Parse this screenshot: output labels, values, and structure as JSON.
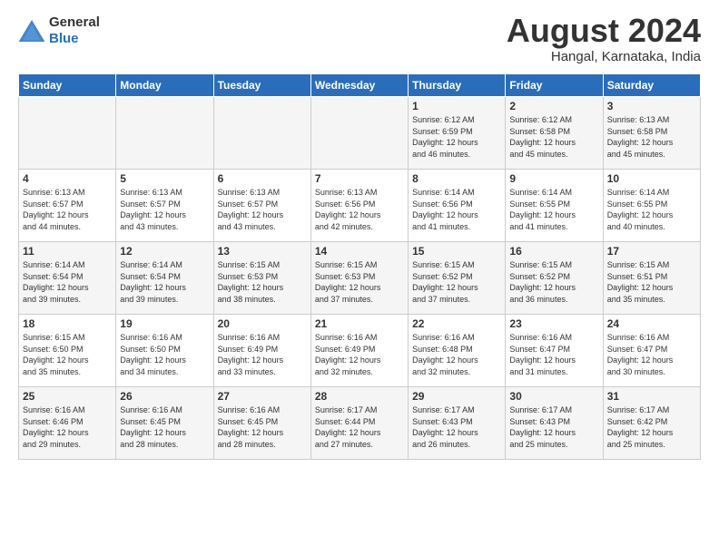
{
  "logo": {
    "text_general": "General",
    "text_blue": "Blue"
  },
  "title": "August 2024",
  "subtitle": "Hangal, Karnataka, India",
  "days_of_week": [
    "Sunday",
    "Monday",
    "Tuesday",
    "Wednesday",
    "Thursday",
    "Friday",
    "Saturday"
  ],
  "weeks": [
    [
      {
        "day": "",
        "info": ""
      },
      {
        "day": "",
        "info": ""
      },
      {
        "day": "",
        "info": ""
      },
      {
        "day": "",
        "info": ""
      },
      {
        "day": "1",
        "info": "Sunrise: 6:12 AM\nSunset: 6:59 PM\nDaylight: 12 hours\nand 46 minutes."
      },
      {
        "day": "2",
        "info": "Sunrise: 6:12 AM\nSunset: 6:58 PM\nDaylight: 12 hours\nand 45 minutes."
      },
      {
        "day": "3",
        "info": "Sunrise: 6:13 AM\nSunset: 6:58 PM\nDaylight: 12 hours\nand 45 minutes."
      }
    ],
    [
      {
        "day": "4",
        "info": "Sunrise: 6:13 AM\nSunset: 6:57 PM\nDaylight: 12 hours\nand 44 minutes."
      },
      {
        "day": "5",
        "info": "Sunrise: 6:13 AM\nSunset: 6:57 PM\nDaylight: 12 hours\nand 43 minutes."
      },
      {
        "day": "6",
        "info": "Sunrise: 6:13 AM\nSunset: 6:57 PM\nDaylight: 12 hours\nand 43 minutes."
      },
      {
        "day": "7",
        "info": "Sunrise: 6:13 AM\nSunset: 6:56 PM\nDaylight: 12 hours\nand 42 minutes."
      },
      {
        "day": "8",
        "info": "Sunrise: 6:14 AM\nSunset: 6:56 PM\nDaylight: 12 hours\nand 41 minutes."
      },
      {
        "day": "9",
        "info": "Sunrise: 6:14 AM\nSunset: 6:55 PM\nDaylight: 12 hours\nand 41 minutes."
      },
      {
        "day": "10",
        "info": "Sunrise: 6:14 AM\nSunset: 6:55 PM\nDaylight: 12 hours\nand 40 minutes."
      }
    ],
    [
      {
        "day": "11",
        "info": "Sunrise: 6:14 AM\nSunset: 6:54 PM\nDaylight: 12 hours\nand 39 minutes."
      },
      {
        "day": "12",
        "info": "Sunrise: 6:14 AM\nSunset: 6:54 PM\nDaylight: 12 hours\nand 39 minutes."
      },
      {
        "day": "13",
        "info": "Sunrise: 6:15 AM\nSunset: 6:53 PM\nDaylight: 12 hours\nand 38 minutes."
      },
      {
        "day": "14",
        "info": "Sunrise: 6:15 AM\nSunset: 6:53 PM\nDaylight: 12 hours\nand 37 minutes."
      },
      {
        "day": "15",
        "info": "Sunrise: 6:15 AM\nSunset: 6:52 PM\nDaylight: 12 hours\nand 37 minutes."
      },
      {
        "day": "16",
        "info": "Sunrise: 6:15 AM\nSunset: 6:52 PM\nDaylight: 12 hours\nand 36 minutes."
      },
      {
        "day": "17",
        "info": "Sunrise: 6:15 AM\nSunset: 6:51 PM\nDaylight: 12 hours\nand 35 minutes."
      }
    ],
    [
      {
        "day": "18",
        "info": "Sunrise: 6:15 AM\nSunset: 6:50 PM\nDaylight: 12 hours\nand 35 minutes."
      },
      {
        "day": "19",
        "info": "Sunrise: 6:16 AM\nSunset: 6:50 PM\nDaylight: 12 hours\nand 34 minutes."
      },
      {
        "day": "20",
        "info": "Sunrise: 6:16 AM\nSunset: 6:49 PM\nDaylight: 12 hours\nand 33 minutes."
      },
      {
        "day": "21",
        "info": "Sunrise: 6:16 AM\nSunset: 6:49 PM\nDaylight: 12 hours\nand 32 minutes."
      },
      {
        "day": "22",
        "info": "Sunrise: 6:16 AM\nSunset: 6:48 PM\nDaylight: 12 hours\nand 32 minutes."
      },
      {
        "day": "23",
        "info": "Sunrise: 6:16 AM\nSunset: 6:47 PM\nDaylight: 12 hours\nand 31 minutes."
      },
      {
        "day": "24",
        "info": "Sunrise: 6:16 AM\nSunset: 6:47 PM\nDaylight: 12 hours\nand 30 minutes."
      }
    ],
    [
      {
        "day": "25",
        "info": "Sunrise: 6:16 AM\nSunset: 6:46 PM\nDaylight: 12 hours\nand 29 minutes."
      },
      {
        "day": "26",
        "info": "Sunrise: 6:16 AM\nSunset: 6:45 PM\nDaylight: 12 hours\nand 28 minutes."
      },
      {
        "day": "27",
        "info": "Sunrise: 6:16 AM\nSunset: 6:45 PM\nDaylight: 12 hours\nand 28 minutes."
      },
      {
        "day": "28",
        "info": "Sunrise: 6:17 AM\nSunset: 6:44 PM\nDaylight: 12 hours\nand 27 minutes."
      },
      {
        "day": "29",
        "info": "Sunrise: 6:17 AM\nSunset: 6:43 PM\nDaylight: 12 hours\nand 26 minutes."
      },
      {
        "day": "30",
        "info": "Sunrise: 6:17 AM\nSunset: 6:43 PM\nDaylight: 12 hours\nand 25 minutes."
      },
      {
        "day": "31",
        "info": "Sunrise: 6:17 AM\nSunset: 6:42 PM\nDaylight: 12 hours\nand 25 minutes."
      }
    ]
  ]
}
